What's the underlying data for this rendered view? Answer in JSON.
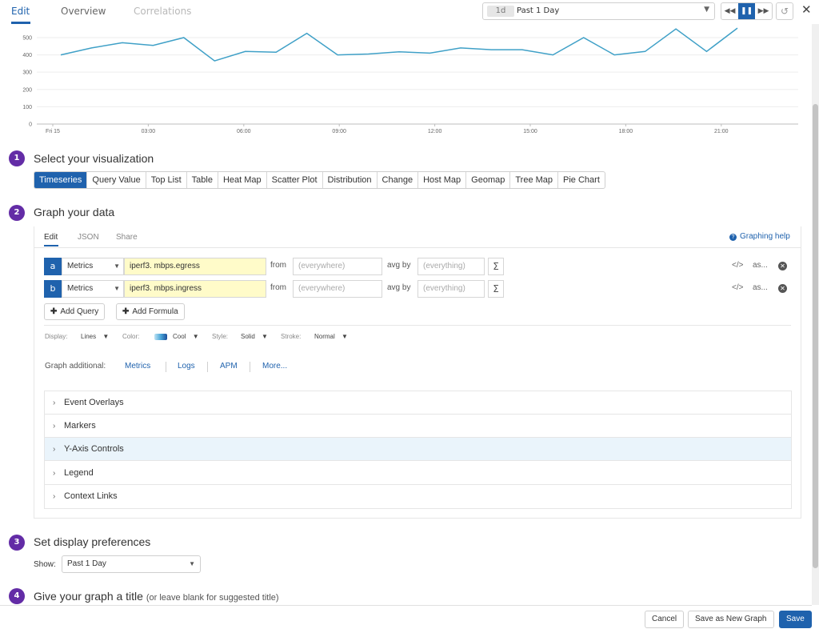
{
  "tabs": [
    {
      "label": "Edit",
      "state": "active"
    },
    {
      "label": "Overview",
      "state": "normal"
    },
    {
      "label": "Correlations",
      "state": "disabled"
    }
  ],
  "timepicker": {
    "badge": "1d",
    "label": "Past 1 Day"
  },
  "chart_data": {
    "type": "line",
    "yticks": [
      "500",
      "400",
      "300",
      "200",
      "100",
      "0"
    ],
    "xticks": [
      "Fri 15",
      "03:00",
      "06:00",
      "09:00",
      "12:00",
      "15:00",
      "18:00",
      "21:00"
    ],
    "ylim": [
      0,
      560
    ],
    "series": [
      {
        "color": "#3fa0c7",
        "values": [
          400,
          440,
          470,
          455,
          500,
          365,
          420,
          415,
          525,
          400,
          405,
          418,
          410,
          440,
          430,
          430,
          400,
          500,
          400,
          420,
          550,
          420,
          555
        ]
      }
    ]
  },
  "steps": {
    "s1": {
      "num": "1",
      "title": "Select your visualization"
    },
    "s2": {
      "num": "2",
      "title": "Graph your data"
    },
    "s3": {
      "num": "3",
      "title": "Set display preferences"
    },
    "s4": {
      "num": "4",
      "title": "Give your graph a title",
      "hint": "(or leave blank for suggested title)"
    }
  },
  "viz": [
    "Timeseries",
    "Query Value",
    "Top List",
    "Table",
    "Heat Map",
    "Scatter Plot",
    "Distribution",
    "Change",
    "Host Map",
    "Geomap",
    "Tree Map",
    "Pie Chart"
  ],
  "subtabs": {
    "edit": "Edit",
    "json": "JSON",
    "share": "Share"
  },
  "graphing_help": "Graphing help",
  "queries": [
    {
      "letter": "a",
      "source": "Metrics",
      "metric": "iperf3.        mbps.egress",
      "from_label": "from",
      "from": "(everywhere)",
      "avg_label": "avg by",
      "avg": "(everything)",
      "sigma": "Σ",
      "code": "</>",
      "as": "as..."
    },
    {
      "letter": "b",
      "source": "Metrics",
      "metric": "iperf3.        mbps.ingress",
      "from_label": "from",
      "from": "(everywhere)",
      "avg_label": "avg by",
      "avg": "(everything)",
      "sigma": "Σ",
      "code": "</>",
      "as": "as..."
    }
  ],
  "add_query": "Add Query",
  "add_formula": "Add Formula",
  "display": {
    "display_label": "Display:",
    "display_value": "Lines",
    "color_label": "Color:",
    "color_value": "Cool",
    "style_label": "Style:",
    "style_value": "Solid",
    "stroke_label": "Stroke:",
    "stroke_value": "Normal"
  },
  "graph_additional": {
    "label": "Graph additional:",
    "links": [
      "Metrics",
      "Logs",
      "APM",
      "More..."
    ]
  },
  "accordion": [
    "Event Overlays",
    "Markers",
    "Y-Axis Controls",
    "Legend",
    "Context Links"
  ],
  "show": {
    "label": "Show:",
    "value": "Past 1 Day"
  },
  "footer": {
    "cancel": "Cancel",
    "save_new": "Save as New Graph",
    "save": "Save"
  }
}
